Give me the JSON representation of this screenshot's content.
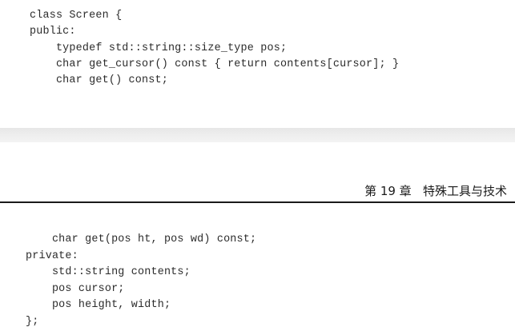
{
  "top_code": [
    "class Screen {",
    "public:",
    "    typedef std::string::size_type pos;",
    "    char get_cursor() const { return contents[cursor]; }",
    "    char get() const;"
  ],
  "chapter_header": "第 19 章   特殊工具与技术",
  "bottom_code": [
    "    char get(pos ht, pos wd) const;",
    "private:",
    "    std::string contents;",
    "    pos cursor;",
    "    pos height, width;",
    "};"
  ]
}
